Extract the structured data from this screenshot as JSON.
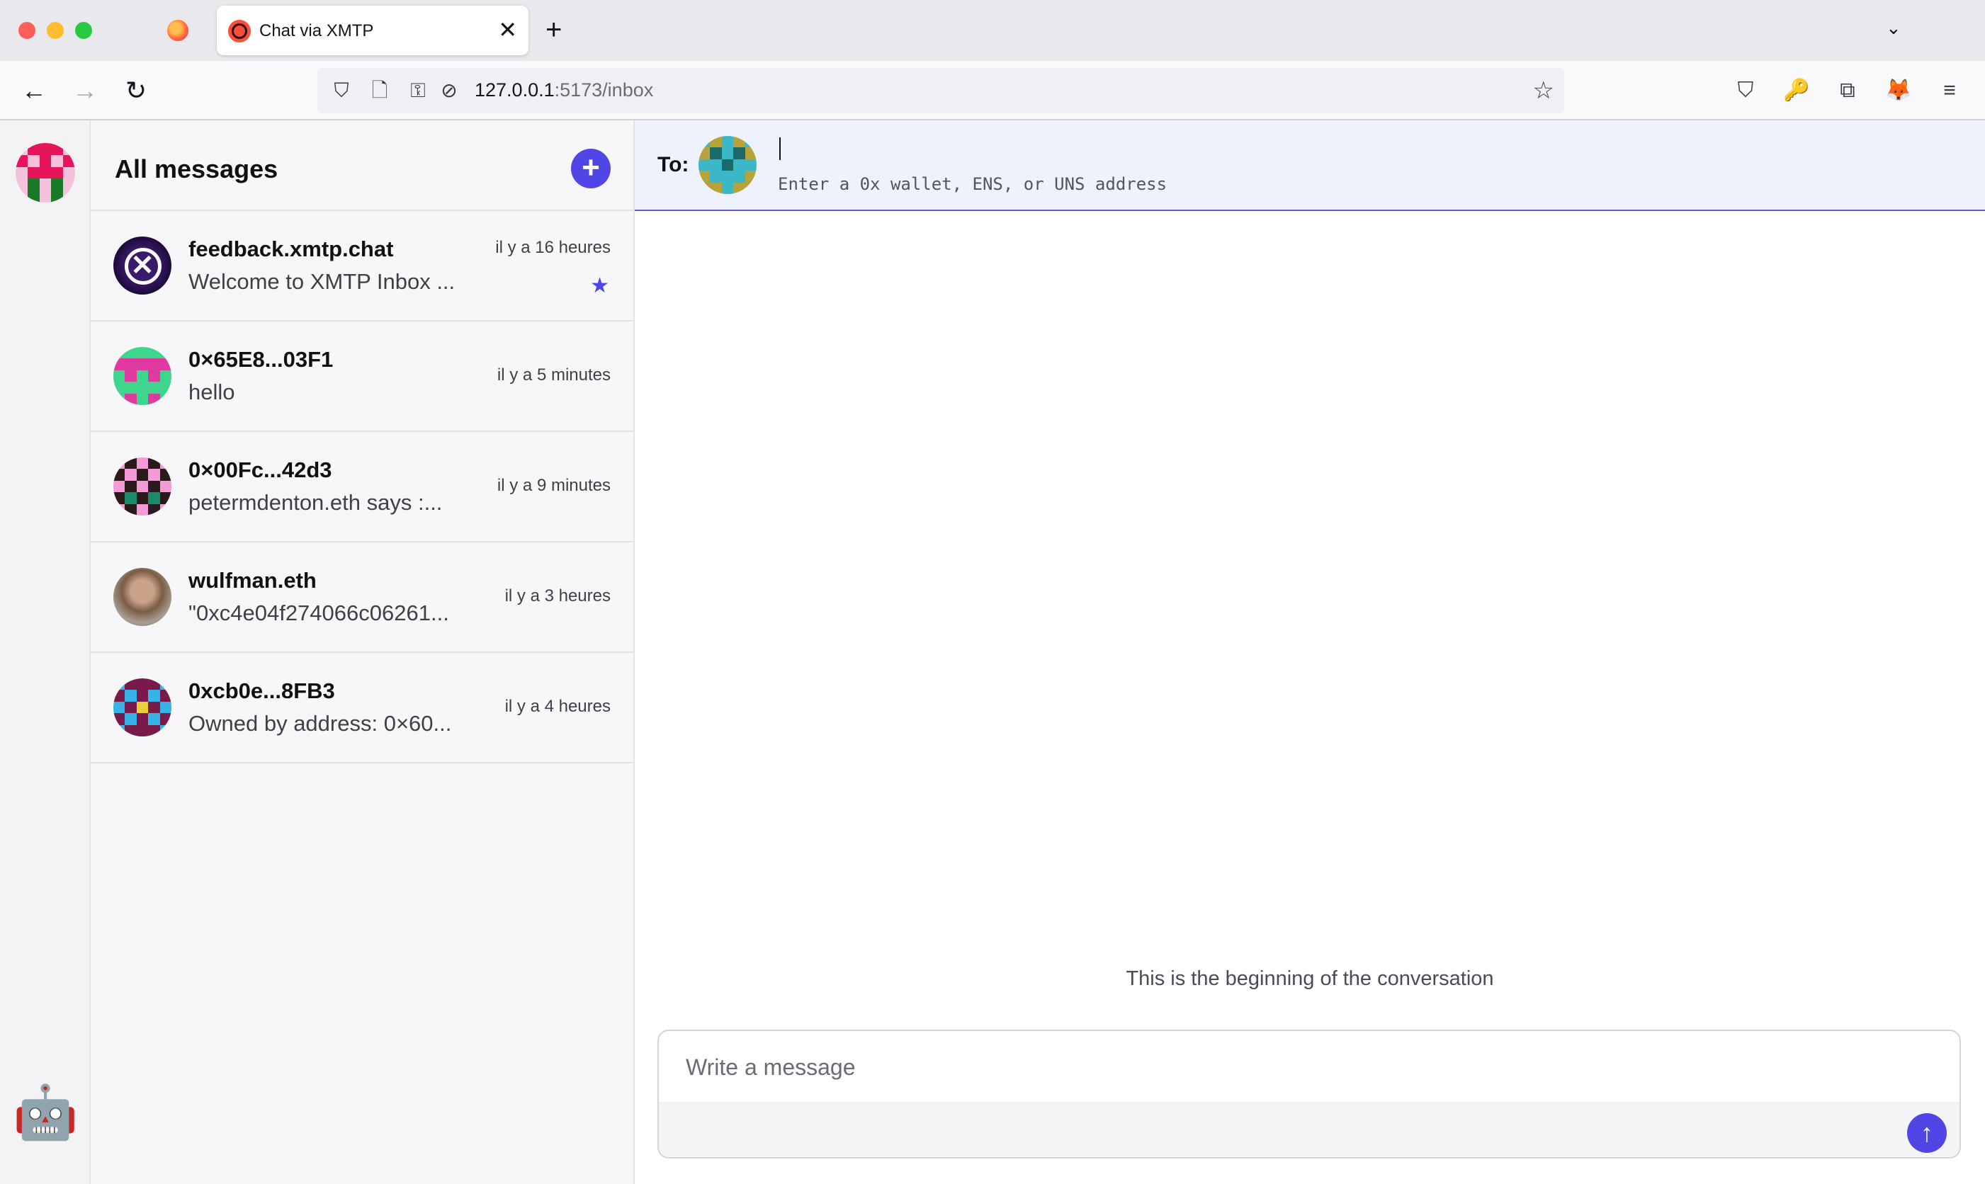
{
  "browser": {
    "tab_title": "Chat via XMTP",
    "tab_close": "✕",
    "new_tab": "+",
    "tab_list": "⌄",
    "url_host": "127.0.0.1",
    "url_rest": ":5173/inbox",
    "nav": {
      "back": "←",
      "forward": "→",
      "reload": "↻"
    },
    "icons": {
      "shield": "⛉",
      "page": "🗋",
      "permissions": "⚿",
      "camera_blocked": "⊘",
      "bookmark": "☆",
      "pocket": "⛉",
      "key": "🔑",
      "extensions": "⧉",
      "metamask": "🦊",
      "menu": "≡"
    }
  },
  "sidebar": {
    "bot_icon": "🤖"
  },
  "conversation_list": {
    "title": "All messages",
    "new_button": "+",
    "conversations": [
      {
        "name": "feedback.xmtp.chat",
        "preview": "Welcome to XMTP Inbox ...",
        "time": "il y a 16 heures",
        "starred": "★"
      },
      {
        "name": "0×65E8...03F1",
        "preview": "hello",
        "time": "il y a 5 minutes"
      },
      {
        "name": "0×00Fc...42d3",
        "preview": "petermdenton.eth says :...",
        "time": "il y a 9 minutes"
      },
      {
        "name": "wulfman.eth",
        "preview": "\"0xc4e04f274066c06261...",
        "time": "il y a 3 heures"
      },
      {
        "name": "0xcb0e...8FB3",
        "preview": "Owned by address: 0×60...",
        "time": "il y a 4 heures"
      }
    ]
  },
  "chat": {
    "to_label": "To:",
    "to_hint": "Enter a 0x wallet, ENS, or UNS address",
    "to_value": "",
    "beginning_text": "This is the beginning of the conversation",
    "composer_placeholder": "Write a message",
    "send_icon": "↑"
  },
  "colors": {
    "accent": "#4f46e5",
    "to_bar_bg": "#eef2fc"
  }
}
